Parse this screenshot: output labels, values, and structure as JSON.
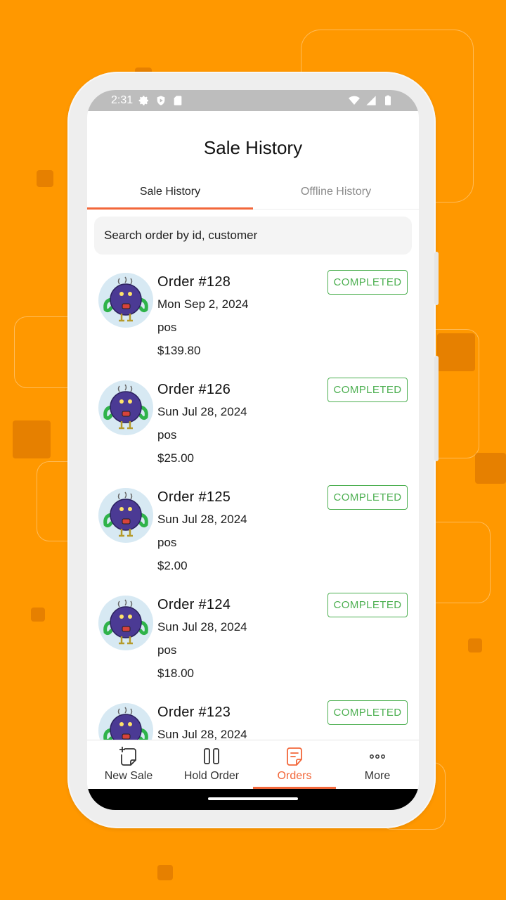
{
  "status_bar": {
    "time": "2:31"
  },
  "header": {
    "title": "Sale History"
  },
  "tabs": [
    {
      "label": "Sale History",
      "active": true
    },
    {
      "label": "Offline History",
      "active": false
    }
  ],
  "search": {
    "placeholder": "Search order by id, customer"
  },
  "orders": [
    {
      "title": "Order #128",
      "date": "Mon Sep 2, 2024",
      "source": "pos",
      "total": "$139.80",
      "status": "COMPLETED"
    },
    {
      "title": "Order #126",
      "date": "Sun Jul 28, 2024",
      "source": "pos",
      "total": "$25.00",
      "status": "COMPLETED"
    },
    {
      "title": "Order #125",
      "date": "Sun Jul 28, 2024",
      "source": "pos",
      "total": "$2.00",
      "status": "COMPLETED"
    },
    {
      "title": "Order #124",
      "date": "Sun Jul 28, 2024",
      "source": "pos",
      "total": "$18.00",
      "status": "COMPLETED"
    },
    {
      "title": "Order #123",
      "date": "Sun Jul 28, 2024",
      "source": "",
      "total": "",
      "status": "COMPLETED"
    }
  ],
  "bottom_nav": [
    {
      "label": "New Sale",
      "icon": "new-sale-icon",
      "active": false
    },
    {
      "label": "Hold Order",
      "icon": "pause-icon",
      "active": false
    },
    {
      "label": "Orders",
      "icon": "orders-icon",
      "active": true
    },
    {
      "label": "More",
      "icon": "more-icon",
      "active": false
    }
  ],
  "colors": {
    "background": "#FF9800",
    "accent": "#F2673A",
    "completed": "#4CAF50"
  }
}
